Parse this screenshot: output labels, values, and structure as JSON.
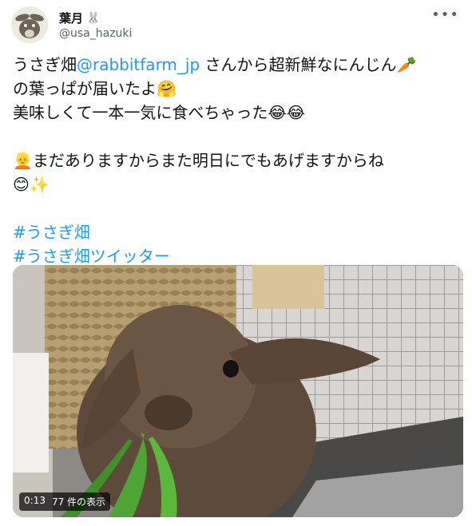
{
  "user": {
    "display_name": "葉月",
    "name_emoji": "🐰",
    "handle": "@usa_hazuki"
  },
  "more_icon": "more-options-icon",
  "tweet": {
    "line1_prefix": "うさぎ畑",
    "line1_mention": "@rabbitfarm_jp",
    "line1_suffix": " さんから超新鮮なにんじん🥕",
    "line2": "の葉っぱが届いたよ🤗",
    "line3": "美味しくて一本一気に食べちゃった😂😂",
    "line5": "👱まだありますからまた明日にでもあげますからね",
    "line6": "😊✨",
    "hashtag1": "#うさぎ畑",
    "hashtag2": "#うさぎ畑ツイッター"
  },
  "video": {
    "duration": "0:13",
    "views": "77 件の表示"
  },
  "colors": {
    "link": "#1d9bf0",
    "text": "#0f1419",
    "muted": "#536471"
  }
}
